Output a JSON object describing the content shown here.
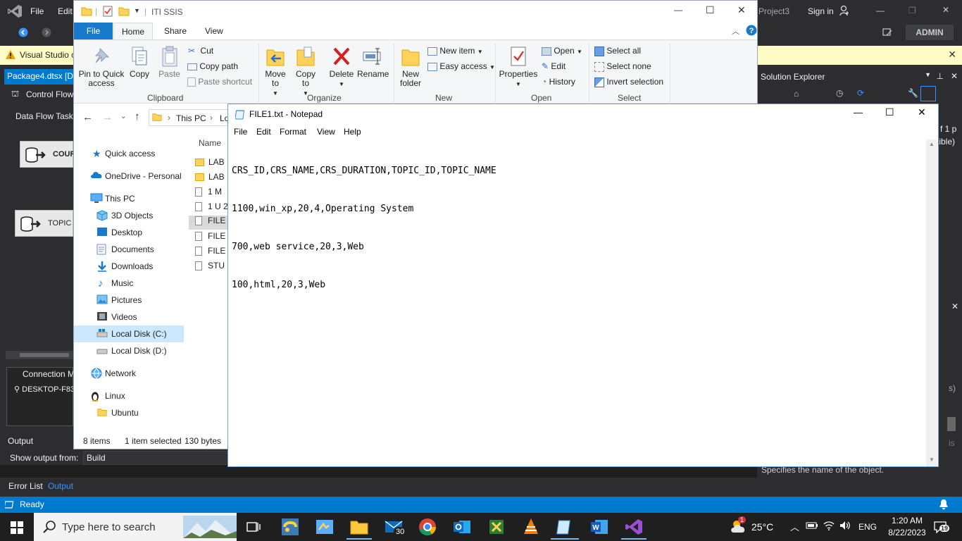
{
  "vs": {
    "menu_file": "File",
    "menu_edit": "Edit",
    "project_name": "Project3",
    "sign_in": "Sign in",
    "user": "ADMIN",
    "info_bar": "Visual Studio c",
    "doc_tab": "Package4.dtsx [De",
    "control_flow_tab": "Control Flow",
    "data_flow_task_label": "Data Flow Task:",
    "component_1": "COUR",
    "component_2": "TOPIC",
    "conn_manager_header": "Connection Ma",
    "conn_item": "DESKTOP-F83",
    "output_label": "Output",
    "show_output_from": "Show output from:",
    "output_source": "Build",
    "error_list_tab": "Error List",
    "output_tab": "Output",
    "status": "Ready",
    "solution_explorer_title": "Solution Explorer",
    "right_fragment_1": "f 1 p",
    "right_fragment_2": "tible)",
    "right_fragment_3": "s)",
    "right_fragment_4": "is",
    "property_desc": "Specifies the name of the object."
  },
  "explorer": {
    "title": "ITI SSIS",
    "tabs": {
      "file": "File",
      "home": "Home",
      "share": "Share",
      "view": "View"
    },
    "ribbon": {
      "pin": "Pin to Quick access",
      "copy": "Copy",
      "paste": "Paste",
      "cut": "Cut",
      "copy_path": "Copy path",
      "paste_shortcut": "Paste shortcut",
      "clipboard": "Clipboard",
      "move_to": "Move to",
      "copy_to": "Copy to",
      "delete": "Delete",
      "rename": "Rename",
      "organize": "Organize",
      "new_folder": "New folder",
      "new_item": "New item",
      "easy_access": "Easy access",
      "new": "New",
      "properties": "Properties",
      "open": "Open",
      "edit": "Edit",
      "history": "History",
      "open_group": "Open",
      "select_all": "Select all",
      "select_none": "Select none",
      "invert_selection": "Invert selection",
      "select_group": "Select"
    },
    "address": {
      "this_pc": "This PC",
      "local": "Lo"
    },
    "column_name": "Name",
    "nav": {
      "quick_access": "Quick access",
      "onedrive": "OneDrive - Personal",
      "this_pc": "This PC",
      "objects3d": "3D Objects",
      "desktop": "Desktop",
      "documents": "Documents",
      "downloads": "Downloads",
      "music": "Music",
      "pictures": "Pictures",
      "videos": "Videos",
      "local_c": "Local Disk (C:)",
      "local_d": "Local Disk (D:)",
      "network": "Network",
      "linux": "Linux",
      "ubuntu": "Ubuntu"
    },
    "files": [
      "LAB",
      "LAB",
      "1 M",
      "1 U 2",
      "FILE",
      "FILE",
      "FILE",
      "STU"
    ],
    "status": {
      "items": "8 items",
      "selected": "1 item selected",
      "size": "130 bytes"
    }
  },
  "notepad": {
    "title": "FILE1.txt - Notepad",
    "menu": {
      "file": "File",
      "edit": "Edit",
      "format": "Format",
      "view": "View",
      "help": "Help"
    },
    "lines": [
      "CRS_ID,CRS_NAME,CRS_DURATION,TOPIC_ID,TOPIC_NAME",
      "1100,win_xp,20,4,Operating System",
      "700,web service,20,3,Web",
      "100,html,20,3,Web"
    ]
  },
  "taskbar": {
    "search_placeholder": "Type here to search",
    "mail_badge": "30",
    "weather_badge": "1",
    "temperature": "25°C",
    "lang": "ENG",
    "time": "1:20 AM",
    "date": "8/22/2023",
    "notif_count": "19"
  }
}
